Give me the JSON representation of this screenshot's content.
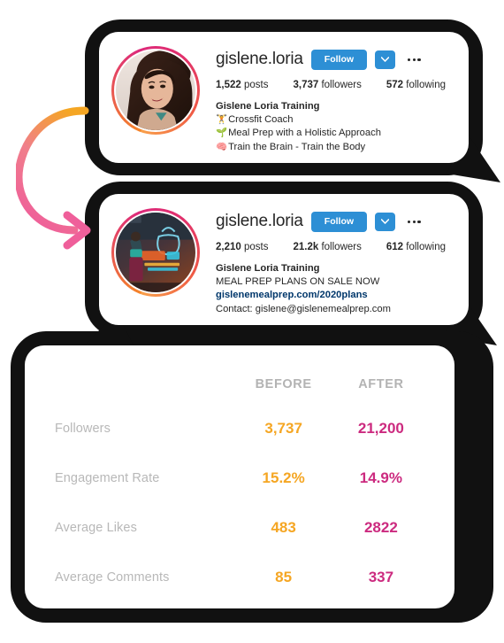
{
  "colors": {
    "instagram_blue": "#2d8fd5",
    "before_accent": "#f5a623",
    "after_accent": "#cc2a7f",
    "label_gray": "#b8b8b8",
    "frame_black": "#111111",
    "link_blue": "#00376b",
    "arrow_start": "#f5a623",
    "arrow_end": "#ef5f9a"
  },
  "profiles": [
    {
      "id": "before",
      "username": "gislene.loria",
      "follow_label": "Follow",
      "avatar_alt": "woman-portrait-selfie",
      "stats": [
        {
          "value": "1,522",
          "label": "posts"
        },
        {
          "value": "3,737",
          "label": "followers"
        },
        {
          "value": "572",
          "label": "following"
        }
      ],
      "bio": {
        "name": "Gislene Loria Training",
        "lines": [
          {
            "emoji": "🏋️",
            "text": "Crossfit Coach"
          },
          {
            "emoji": "🌱",
            "text": "Meal Prep with a Holistic Approach"
          },
          {
            "emoji": "🧠",
            "text": "Train the Brain - Train the Body"
          }
        ]
      }
    },
    {
      "id": "after",
      "username": "gislene.loria",
      "follow_label": "Follow",
      "avatar_alt": "gym-neon-sign-photo",
      "stats": [
        {
          "value": "2,210",
          "label": "posts"
        },
        {
          "value": "21.2k",
          "label": "followers"
        },
        {
          "value": "612",
          "label": "following"
        }
      ],
      "bio": {
        "name": "Gislene Loria Training",
        "headline": "MEAL PREP PLANS ON SALE NOW",
        "link": "gislenemealprep.com/2020plans",
        "contact": "Contact: gislene@gislenemealprep.com"
      }
    }
  ],
  "comparison": {
    "headers": {
      "label": "",
      "before": "BEFORE",
      "after": "AFTER"
    },
    "rows": [
      {
        "label": "Followers",
        "before": "3,737",
        "after": "21,200"
      },
      {
        "label": "Engagement Rate",
        "before": "15.2%",
        "after": "14.9%"
      },
      {
        "label": "Average Likes",
        "before": "483",
        "after": "2822"
      },
      {
        "label": "Average Comments",
        "before": "85",
        "after": "337"
      }
    ]
  }
}
